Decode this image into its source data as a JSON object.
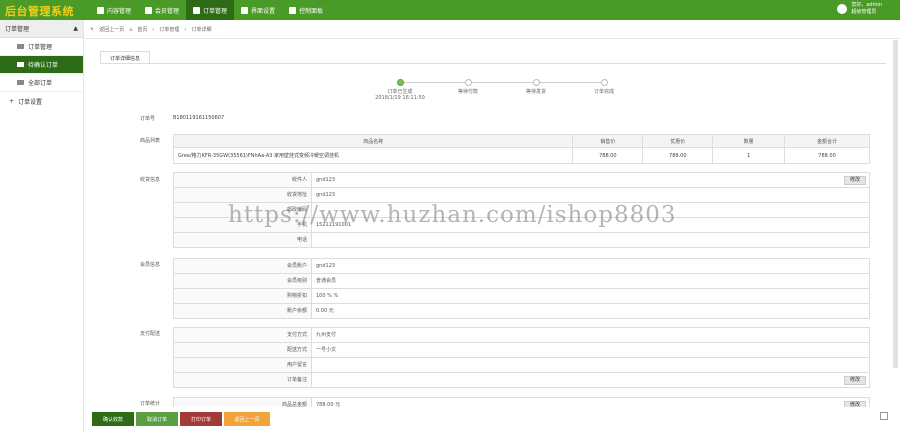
{
  "app": {
    "title": "后台管理系统"
  },
  "nav": [
    {
      "label": "内容管理"
    },
    {
      "label": "会员管理"
    },
    {
      "label": "订单管理"
    },
    {
      "label": "界面设置"
    },
    {
      "label": "控制面板"
    }
  ],
  "user": {
    "greeting": "您好，admin",
    "role": "超级管理员"
  },
  "sidebar": {
    "group1": "订单管理",
    "items": [
      {
        "label": "订单管理"
      },
      {
        "label": "待确认订单"
      },
      {
        "label": "全部订单"
      }
    ],
    "group2": "订单设置"
  },
  "breadcrumb": {
    "back": "返回上一页",
    "home": "首页",
    "mid": "订单管理",
    "current": "订单详细"
  },
  "tab": {
    "label": "订单详细信息"
  },
  "steps": [
    {
      "label": "订单已生成",
      "time": "2018/1/19 16:11:50"
    },
    {
      "label": "等待付款"
    },
    {
      "label": "等待发货"
    },
    {
      "label": "订单完成"
    }
  ],
  "order": {
    "label": "订单号",
    "number": "B180119161150607"
  },
  "goods": {
    "label": "商品列表",
    "headers": [
      "商品名称",
      "销售价",
      "优惠价",
      "数量",
      "金额合计"
    ],
    "rows": [
      {
        "name": "Gree/格力KFR-35GW(35561)FNhAa-A3 家用壁挂式变频冷暖空调挂机",
        "price": "788.00",
        "discount": "788.00",
        "qty": "1",
        "total": "788.00"
      }
    ]
  },
  "receiver": {
    "label": "收货信息",
    "rows": [
      {
        "k": "收件人",
        "v": "gnd123",
        "edit": "修改"
      },
      {
        "k": "收货地址",
        "v": "gnd123"
      },
      {
        "k": "邮政编码",
        "v": ""
      },
      {
        "k": "手机",
        "v": "15212191001"
      },
      {
        "k": "电话",
        "v": ""
      }
    ]
  },
  "member": {
    "label": "会员信息",
    "rows": [
      {
        "k": "会员账户",
        "v": "gnd123"
      },
      {
        "k": "会员级别",
        "v": "普通会员"
      },
      {
        "k": "购物折扣",
        "v": "100 % %"
      },
      {
        "k": "账户余额",
        "v": "0.00 元"
      }
    ]
  },
  "payment": {
    "label": "支付配送",
    "rows": [
      {
        "k": "支付方式",
        "v": "九州支付"
      },
      {
        "k": "配送方式",
        "v": "一号小文"
      },
      {
        "k": "用户留言",
        "v": ""
      },
      {
        "k": "订单备注",
        "v": "",
        "edit": "修改"
      }
    ]
  },
  "stats": {
    "label": "订单统计",
    "k": "商品总金额",
    "v": "788.00 元",
    "edit": "修改"
  },
  "watermark": "https://www.huzhan.com/ishop8803",
  "buttons": [
    {
      "label": "确认收款"
    },
    {
      "label": "取消订单"
    },
    {
      "label": "打印订单"
    },
    {
      "label": "返回上一页"
    }
  ]
}
